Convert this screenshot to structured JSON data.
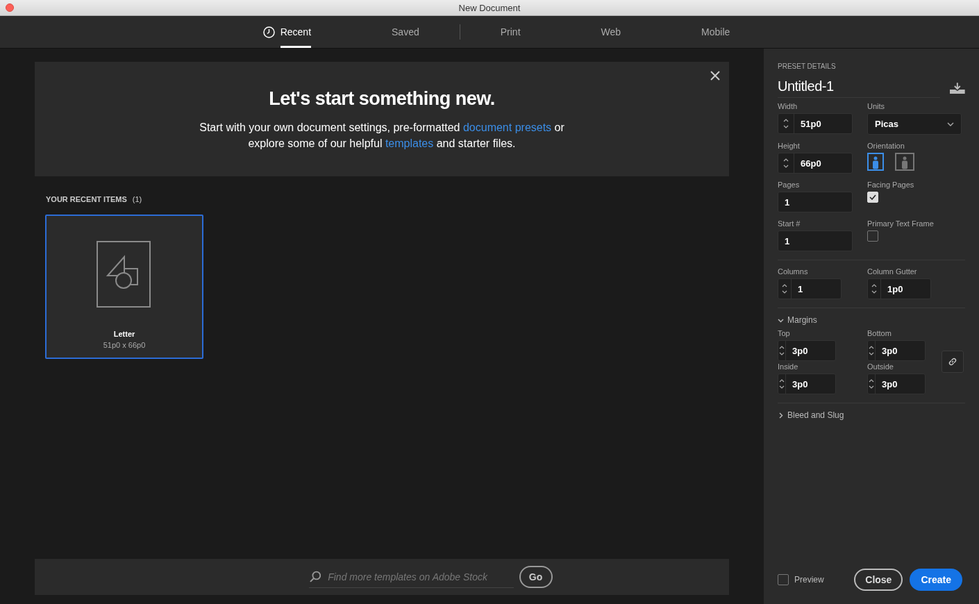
{
  "window": {
    "title": "New Document"
  },
  "tabs": [
    {
      "label": "Recent",
      "selected": true,
      "kind": "clock"
    },
    {
      "label": "Saved",
      "selected": false
    },
    {
      "label": "Print",
      "selected": false
    },
    {
      "label": "Web",
      "selected": false
    },
    {
      "label": "Mobile",
      "selected": false
    }
  ],
  "banner": {
    "heading": "Let's start something new.",
    "parts": [
      {
        "kind": "text",
        "text": "Start with your own document settings, pre-formatted "
      },
      {
        "kind": "link",
        "text": "document presets"
      },
      {
        "kind": "text",
        "text": " or explore some of our helpful "
      },
      {
        "kind": "link",
        "text": "templates"
      },
      {
        "kind": "text",
        "text": " and starter files."
      }
    ]
  },
  "recent": {
    "heading": "YOUR RECENT ITEMS",
    "count": "(1)",
    "items": [
      {
        "name": "Letter",
        "size": "51p0 x 66p0",
        "selected": true
      }
    ]
  },
  "search": {
    "placeholder": "Find more templates on Adobe Stock",
    "button": "Go"
  },
  "preset": {
    "heading": "PRESET DETAILS",
    "name": "Untitled-1",
    "width": {
      "label": "Width",
      "value": "51p0"
    },
    "units": {
      "label": "Units",
      "value": "Picas"
    },
    "height": {
      "label": "Height",
      "value": "66p0"
    },
    "orientation": {
      "label": "Orientation",
      "options": [
        {
          "kind": "portrait",
          "selected": true
        },
        {
          "kind": "landscape",
          "selected": false
        }
      ]
    },
    "pages": {
      "label": "Pages",
      "value": "1"
    },
    "facing_pages": {
      "label": "Facing Pages",
      "checked": true
    },
    "start": {
      "label": "Start #",
      "value": "1"
    },
    "primary_text_frame": {
      "label": "Primary Text Frame",
      "checked": false
    },
    "columns": {
      "label": "Columns",
      "value": "1"
    },
    "column_gutter": {
      "label": "Column Gutter",
      "value": "1p0"
    },
    "margins": {
      "label": "Margins",
      "expanded": true,
      "fields": [
        {
          "label": "Top",
          "value": "3p0"
        },
        {
          "label": "Bottom",
          "value": "3p0"
        },
        {
          "label": "Inside",
          "value": "3p0"
        },
        {
          "label": "Outside",
          "value": "3p0"
        }
      ]
    },
    "bleed": {
      "label": "Bleed and Slug",
      "expanded": false
    }
  },
  "footer": {
    "preview": {
      "label": "Preview",
      "checked": false
    },
    "buttons": [
      {
        "label": "Close",
        "kind": "secondary"
      },
      {
        "label": "Create",
        "kind": "primary"
      }
    ]
  }
}
